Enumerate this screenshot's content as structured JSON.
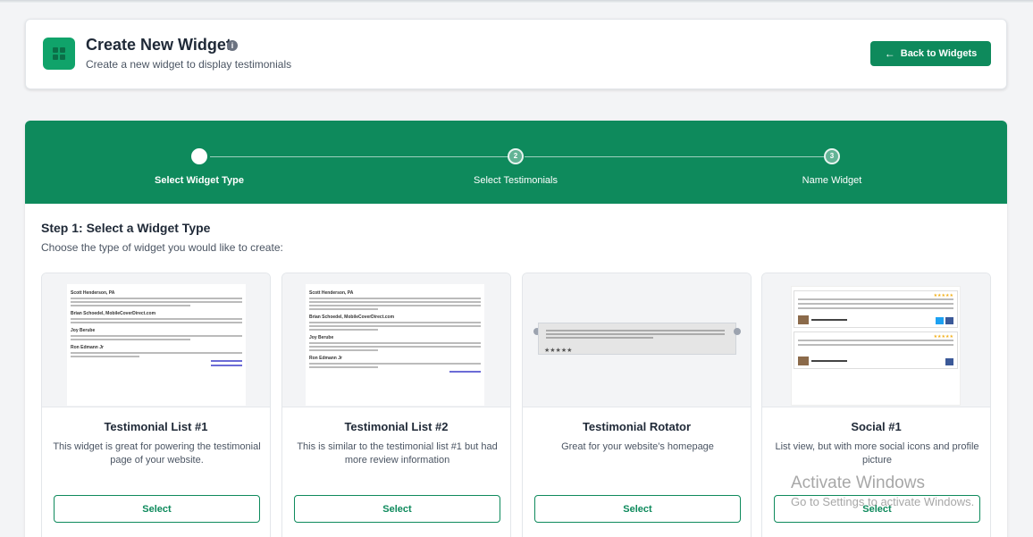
{
  "header": {
    "title": "Create New Widget",
    "subtitle": "Create a new widget to display testimonials",
    "back_label": "Back to Widgets"
  },
  "stepper": {
    "steps": [
      {
        "number": "",
        "label": "Select Widget Type",
        "active": true
      },
      {
        "number": "2",
        "label": "Select Testimonials",
        "active": false
      },
      {
        "number": "3",
        "label": "Name Widget",
        "active": false
      }
    ]
  },
  "step": {
    "heading": "Step 1: Select a Widget Type",
    "description": "Choose the type of widget you would like to create:"
  },
  "widgets": [
    {
      "name": "Testimonial List #1",
      "description": "This widget is great for powering the testimonial page of your website.",
      "select_label": "Select"
    },
    {
      "name": "Testimonial List #2",
      "description": "This is similar to the testimonial list #1 but had more review information",
      "select_label": "Select"
    },
    {
      "name": "Testimonial Rotator",
      "description": "Great for your website's homepage",
      "select_label": "Select"
    },
    {
      "name": "Social #1",
      "description": "List view, but with more social icons and profile picture",
      "select_label": "Select"
    }
  ],
  "preview": {
    "names": [
      "Scott Henderson, PA",
      "Brian Schoedel, MobileCoverDirect.com",
      "Joy Berube",
      "Ron Edmann Jr"
    ],
    "stars": "★★★★★"
  },
  "watermark": {
    "line1": "Activate Windows",
    "line2": "Go to Settings to activate Windows."
  },
  "colors": {
    "brand": "#0e8a5c",
    "accent": "#10a36a"
  }
}
